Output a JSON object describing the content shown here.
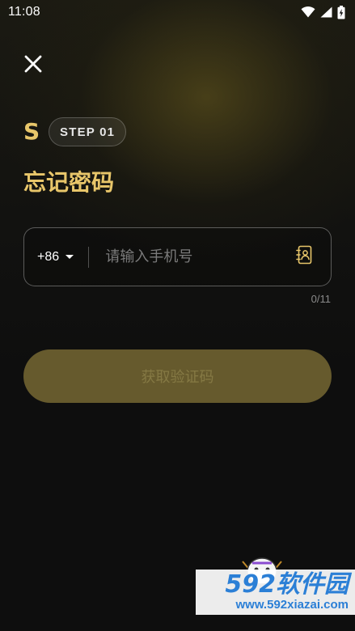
{
  "status_bar": {
    "time": "11:08",
    "icons": [
      "wifi-icon",
      "signal-icon",
      "battery-charging-icon"
    ]
  },
  "header": {
    "close_icon": "close-icon",
    "logo_letter": "S",
    "step_label": "STEP 01"
  },
  "page": {
    "title": "忘记密码"
  },
  "phone_field": {
    "country_code": "+86",
    "placeholder": "请输入手机号",
    "value": "",
    "contacts_icon": "contacts-book-icon",
    "counter": "0/11"
  },
  "actions": {
    "get_code_label": "获取验证码"
  },
  "watermark": {
    "text": "592软件园",
    "url": "www.592xiazai.com"
  },
  "colors": {
    "accent": "#e8c66a",
    "button_disabled_bg": "#665a2d",
    "button_disabled_text": "#857944",
    "background": "#0e0e0e"
  }
}
